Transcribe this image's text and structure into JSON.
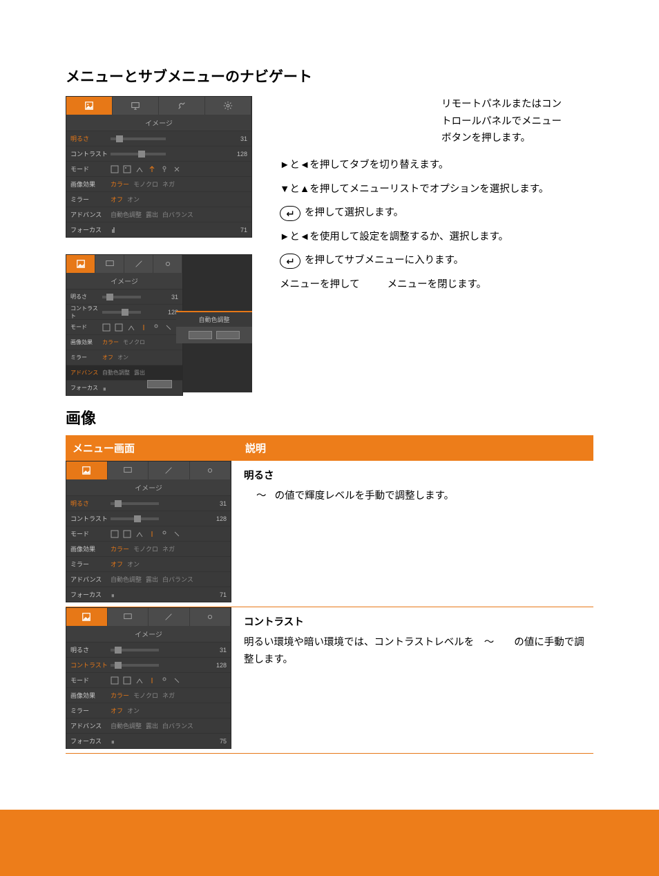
{
  "headings": {
    "nav": "メニューとサブメニューのナビゲート",
    "image": "画像"
  },
  "osd": {
    "subtitle": "イメージ",
    "rows": {
      "brightness": "明るさ",
      "contrast": "コントラスト",
      "mode": "モード",
      "effect": "画像効果",
      "mirror": "ミラー",
      "advance": "アドバンス",
      "focus": "フォーカス"
    },
    "vals": {
      "brightness": "31",
      "contrast": "128",
      "focus1": "71",
      "focus2": "75"
    },
    "effect_opts": {
      "color": "カラー",
      "mono": "モノクロ",
      "neg": "ネガ"
    },
    "mirror_opts": {
      "off": "オフ",
      "on": "オン"
    },
    "advance_opts": {
      "auto": "自動色調整",
      "exposure": "露出",
      "wb": "白バランス"
    },
    "popup_title": "自動色調整"
  },
  "instructions": {
    "intro": "リモートパネルまたはコントロールパネルでメニューボタンを押します。",
    "tab_switch_a": "►と◄を押してタブを切り替えます。",
    "option_select": "▼と▲を押してメニューリストでオプションを選択します。",
    "enter_select": "を押して選択します。",
    "adjust": "►と◄を使用して設定を調整するか、選択します。",
    "enter_submenu": "を押してサブメニューに入ります。",
    "close_a": "メニューを押して",
    "close_b": "メニューを閉じます。"
  },
  "table": {
    "col_menu": "メニュー画面",
    "col_desc": "説明",
    "row1": {
      "title": "明るさ",
      "body_a": "～",
      "body_b": "の値で輝度レベルを手動で調整します。"
    },
    "row2": {
      "title": "コントラスト",
      "body": "明るい環境や暗い環境では、コントラストレベルを　～　　の値に手動で調整します。"
    }
  }
}
